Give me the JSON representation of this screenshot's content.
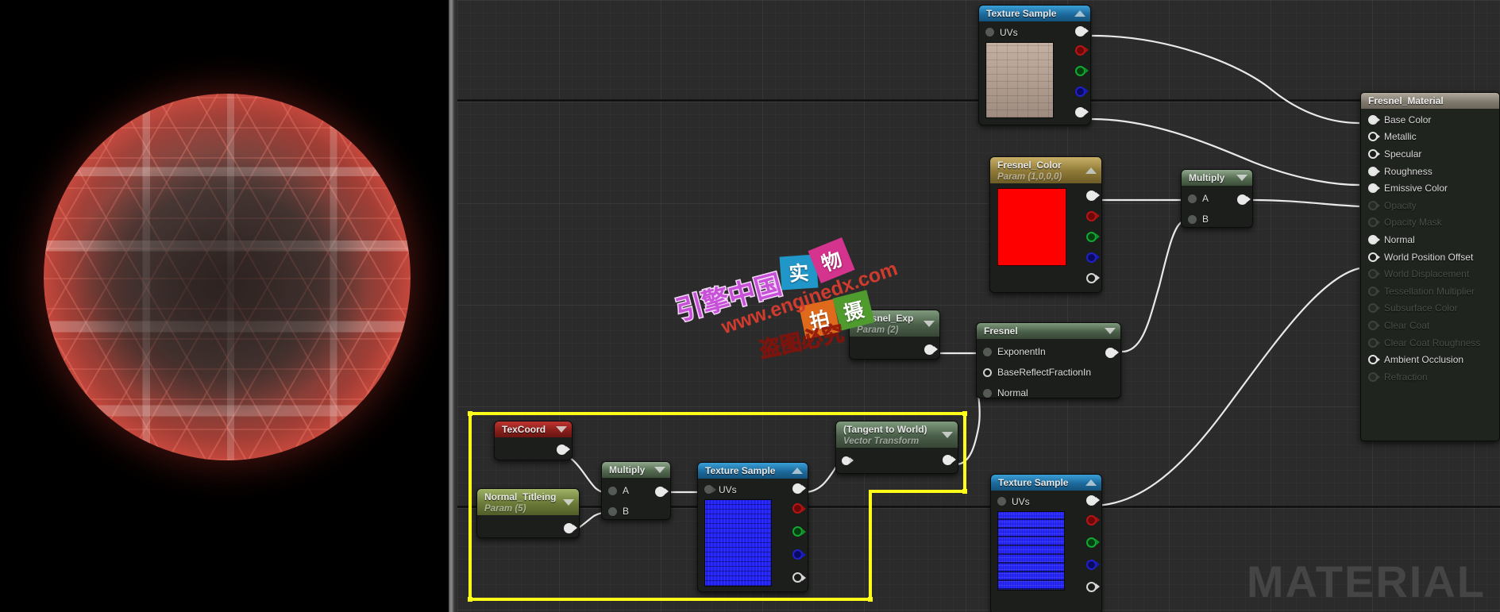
{
  "app": {
    "watermark_material": "MATERIAL"
  },
  "preview": {
    "name": "material-preview-sphere"
  },
  "nodes": {
    "texture_sample_top": {
      "title": "Texture Sample",
      "caret": "collapse-up",
      "inputs": [
        {
          "label": "UVs"
        }
      ],
      "outputs": [
        "rgb",
        "r",
        "g",
        "b",
        "a"
      ]
    },
    "fresnel_color": {
      "title": "Fresnel_Color",
      "subtitle": "Param (1,0,0,0)",
      "caret": "collapse-up",
      "color": "#ff0000",
      "outputs": [
        "rgb",
        "r",
        "g",
        "b",
        "a"
      ]
    },
    "multiply_top": {
      "title": "Multiply",
      "caret": "collapse-down",
      "inputs": [
        {
          "label": "A"
        },
        {
          "label": "B"
        }
      ],
      "outputs": [
        "result"
      ]
    },
    "fresnel_exp": {
      "title": "Fresnel_Exp",
      "subtitle": "Param (2)",
      "caret": "collapse-down",
      "outputs": [
        "result"
      ]
    },
    "fresnel": {
      "title": "Fresnel",
      "caret": "collapse-down",
      "inputs": [
        {
          "label": "ExponentIn"
        },
        {
          "label": "BaseReflectFractionIn"
        },
        {
          "label": "Normal"
        }
      ],
      "outputs": [
        "result"
      ]
    },
    "texcoord": {
      "title": "TexCoord",
      "caret": "collapse-down",
      "outputs": [
        "uv"
      ]
    },
    "normal_tiling": {
      "title": "Normal_Titleing",
      "subtitle": "Param (5)",
      "caret": "collapse-down",
      "outputs": [
        "result"
      ]
    },
    "multiply_bottom": {
      "title": "Multiply",
      "caret": "collapse-down",
      "inputs": [
        {
          "label": "A"
        },
        {
          "label": "B"
        }
      ],
      "outputs": [
        "result"
      ]
    },
    "texture_sample_mid": {
      "title": "Texture Sample",
      "caret": "collapse-up",
      "inputs": [
        {
          "label": "UVs"
        }
      ],
      "outputs": [
        "rgb",
        "r",
        "g",
        "b",
        "a"
      ]
    },
    "vector_transform": {
      "title": "(Tangent to World)",
      "subtitle": "Vector Transform",
      "caret": "collapse-down",
      "inputs": [
        {
          "label": ""
        }
      ],
      "outputs": [
        "result"
      ]
    },
    "texture_sample_bottom": {
      "title": "Texture Sample",
      "caret": "collapse-up",
      "inputs": [
        {
          "label": "UVs"
        }
      ],
      "outputs": [
        "rgb",
        "r",
        "g",
        "b",
        "a"
      ]
    }
  },
  "material_node": {
    "title": "Fresnel_Material",
    "rows": [
      {
        "label": "Base Color",
        "state": "connected"
      },
      {
        "label": "Metallic",
        "state": "enabled"
      },
      {
        "label": "Specular",
        "state": "enabled"
      },
      {
        "label": "Roughness",
        "state": "connected"
      },
      {
        "label": "Emissive Color",
        "state": "connected"
      },
      {
        "label": "Opacity",
        "state": "disabled"
      },
      {
        "label": "Opacity Mask",
        "state": "disabled"
      },
      {
        "label": "Normal",
        "state": "connected"
      },
      {
        "label": "World Position Offset",
        "state": "enabled"
      },
      {
        "label": "World Displacement",
        "state": "disabled"
      },
      {
        "label": "Tessellation Multiplier",
        "state": "disabled"
      },
      {
        "label": "Subsurface Color",
        "state": "disabled"
      },
      {
        "label": "Clear Coat",
        "state": "disabled"
      },
      {
        "label": "Clear Coat Roughness",
        "state": "disabled"
      },
      {
        "label": "Ambient Occlusion",
        "state": "enabled"
      },
      {
        "label": "Refraction",
        "state": "disabled"
      }
    ]
  },
  "watermark": {
    "brand_cn": "引擎中国",
    "url": "www.enginedx.com",
    "warning_cn": "盗图必究",
    "tiles": [
      {
        "text": "实",
        "color": "#2196c9"
      },
      {
        "text": "物",
        "color": "#d4338e"
      },
      {
        "text": "拍",
        "color": "#e06a1c"
      },
      {
        "text": "摄",
        "color": "#4f9b2e"
      }
    ]
  },
  "selection": {
    "name": "node-selection-marquee",
    "color": "#ffff1a"
  }
}
